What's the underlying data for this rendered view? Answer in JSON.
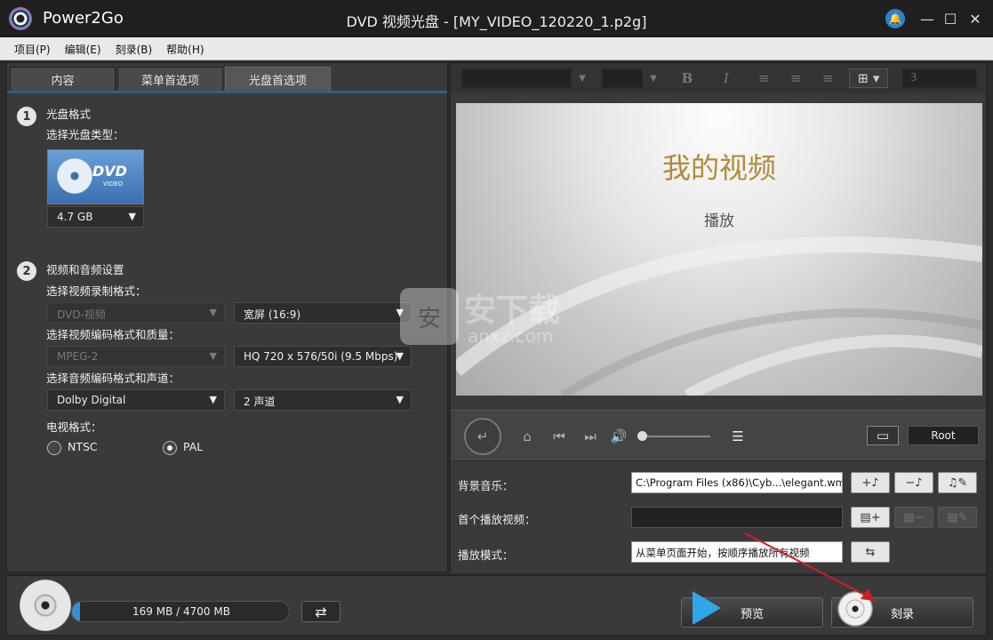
{
  "window": {
    "app_name": "Power2Go",
    "title": "DVD 视频光盘 - [MY_VIDEO_120220_1.p2g]",
    "controls": {
      "minimize": "—",
      "maximize": "☐",
      "close": "✕"
    }
  },
  "menu": [
    "项目(P)",
    "编辑(E)",
    "刻录(B)",
    "帮助(H)"
  ],
  "tabs": [
    "内容",
    "菜单首选项",
    "光盘首选项"
  ],
  "section1": {
    "num": "1",
    "title": "光盘格式",
    "disc_type_label": "选择光盘类型：",
    "disc_logo": "DVD",
    "disc_logo_sub": "VIDEO",
    "disc_size": "4.7 GB"
  },
  "section2": {
    "num": "2",
    "title": "视频和音频设置",
    "video_format_label": "选择视频录制格式：",
    "video_format": "DVD-视频",
    "aspect": "宽屏 (16:9)",
    "video_codec_label": "选择视频编码格式和质量：",
    "video_codec": "MPEG-2",
    "video_quality": "HQ 720 x 576/50i (9.5 Mbps)",
    "audio_label": "选择音频编码格式和声道：",
    "audio_codec": "Dolby Digital",
    "audio_channels": "2 声道",
    "tv_label": "电视格式：",
    "ntsc": "NTSC",
    "pal": "PAL",
    "tv_selected": "PAL"
  },
  "format_toolbar": {
    "bold": "B",
    "italic": "I",
    "size": "3"
  },
  "preview": {
    "title": "我的视频",
    "play": "播放"
  },
  "player": {
    "root_label": "Root",
    "volume_level": 0.0
  },
  "settings": {
    "bg_music_label": "背景音乐：",
    "bg_music_path": "C:\\Program Files (x86)\\Cyb...\\elegant.wma",
    "first_play_label": "首个播放视频：",
    "first_play_value": "",
    "play_mode_label": "播放模式：",
    "play_mode_value": "从菜单页面开始，按顺序播放所有视频"
  },
  "footer": {
    "capacity_text": "169 MB / 4700 MB",
    "capacity_fraction": 0.036,
    "preview_label": "预览",
    "burn_label": "刻录"
  },
  "watermark": {
    "text": "安下载",
    "sub": "anxz.com",
    "badge": "安"
  },
  "colors": {
    "accent": "#2ea6e8",
    "title_gold": "#b08a3a",
    "arrow_red": "#d11f1f"
  }
}
